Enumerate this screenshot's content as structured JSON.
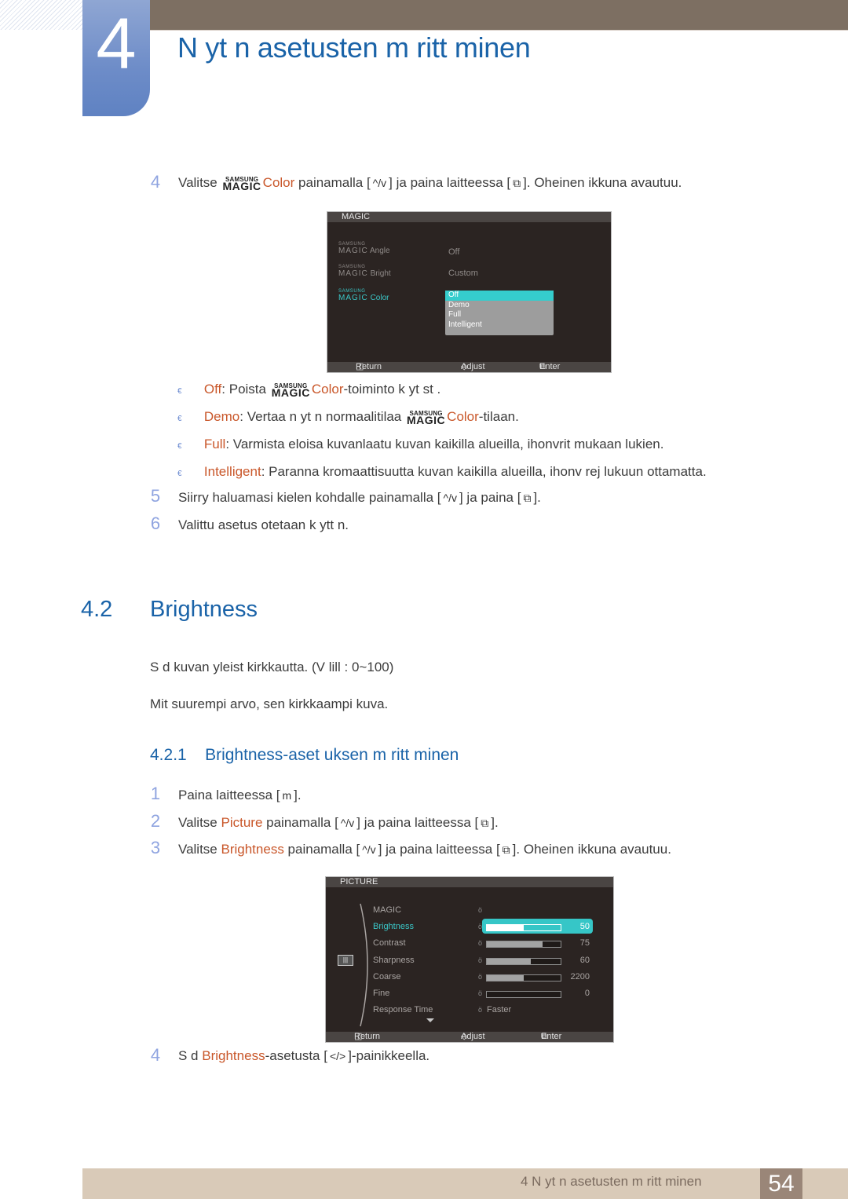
{
  "header": {
    "chapter_number": "4",
    "chapter_title": "N yt n asetusten m  ritt minen"
  },
  "step4_top": {
    "number": "4",
    "pre": "Valitse",
    "magic_small": "SAMSUNG",
    "magic_big": "MAGIC",
    "highlight": "Color",
    "mid": "painamalla [",
    "nav_icon": "^/v",
    "mid2": "] ja paina laitteessa [",
    "enter_icon": "⧉",
    "post": "]. Oheinen ikkuna avautuu."
  },
  "magic_osd": {
    "title": "MAGIC",
    "items": [
      {
        "small": "SAMSUNG",
        "big": "MAGIC",
        "label": "Angle",
        "value": "Off",
        "active": false
      },
      {
        "small": "SAMSUNG",
        "big": "MAGIC",
        "label": "Bright",
        "value": "Custom",
        "active": false
      },
      {
        "small": "SAMSUNG",
        "big": "MAGIC",
        "label": "Color",
        "value": "",
        "active": true
      }
    ],
    "dropdown": [
      "Off",
      "Demo",
      "Full",
      "Intelligent"
    ],
    "dropdown_selected": "Off",
    "footer": {
      "return": "Return",
      "adjust": "Adjust",
      "enter": "Enter"
    }
  },
  "options": [
    {
      "term": "Off",
      "text_pre": ": Poista ",
      "magic": true,
      "term2": "Color",
      "text_post": "-toiminto k yt st ."
    },
    {
      "term": "Demo",
      "text_pre": ": Vertaa n yt n normaalitilaa ",
      "magic": true,
      "term2": "Color",
      "text_post": "-tilaan."
    },
    {
      "term": "Full",
      "text_pre": ": Varmista eloisa kuvanlaatu kuvan kaikilla alueilla, ihonvrit mukaan lukien.",
      "magic": false,
      "term2": "",
      "text_post": ""
    },
    {
      "term": "Intelligent",
      "text_pre": ": Paranna kromaattisuutta kuvan kaikilla alueilla, ihonv rej  lukuun  ottamatta.",
      "magic": false,
      "term2": "",
      "text_post": ""
    }
  ],
  "step5": {
    "number": "5",
    "text": "Siirry haluamasi kielen kohdalle painamalla [",
    "nav_icon": "^/v",
    "text2": "] ja paina [",
    "enter_icon": "⧉",
    "text3": "]."
  },
  "step6": {
    "number": "6",
    "text": "Valittu asetus otetaan k ytt  n."
  },
  "section": {
    "number": "4.2",
    "title": "Brightness",
    "para1": "S  d  kuvan yleist  kirkkautta. (V lill : 0~100)",
    "para2": "Mit  suurempi arvo, sen kirkkaampi kuva."
  },
  "subsection": {
    "number": "4.2.1",
    "title": "Brightness-aset uksen m  ritt minen"
  },
  "steps_b": [
    {
      "number": "1",
      "pre": "Paina laitteessa [",
      "icon": "m",
      "post": "]."
    },
    {
      "number": "2",
      "pre": "Valitse ",
      "highlight": "Picture",
      "mid": " painamalla [",
      "nav_icon": "^/v",
      "mid2": "] ja paina laitteessa [",
      "enter_icon": "⧉",
      "post": "]."
    },
    {
      "number": "3",
      "pre": "Valitse ",
      "highlight": "Brightness",
      "mid": " painamalla [",
      "nav_icon": "^/v",
      "mid2": "] ja paina laitteessa [",
      "enter_icon": "⧉",
      "post": "]. Oheinen ikkuna avautuu."
    }
  ],
  "picture_osd": {
    "title": "PICTURE",
    "items": [
      {
        "label": "MAGIC",
        "value": "",
        "fraction": null,
        "active": false
      },
      {
        "label": "Brightness",
        "value": "50",
        "fraction": 0.5,
        "active": true
      },
      {
        "label": "Contrast",
        "value": "75",
        "fraction": 0.75,
        "active": false
      },
      {
        "label": "Sharpness",
        "value": "60",
        "fraction": 0.6,
        "active": false
      },
      {
        "label": "Coarse",
        "value": "2200",
        "fraction": 0.5,
        "active": false
      },
      {
        "label": "Fine",
        "value": "0",
        "fraction": 0.0,
        "active": false
      },
      {
        "label": "Response Time",
        "value": "Faster",
        "fraction": null,
        "active": false
      }
    ],
    "footer": {
      "return": "Return",
      "adjust": "Adjust",
      "enter": "Enter"
    }
  },
  "step4_bottom": {
    "number": "4",
    "pre": "S  d ",
    "highlight": "Brightness",
    "post": "-asetusta [",
    "icon": "</>",
    "post2": "]-painikkeella."
  },
  "footer": {
    "text": "4 N yt n asetusten m  ritt minen",
    "page": "54"
  }
}
